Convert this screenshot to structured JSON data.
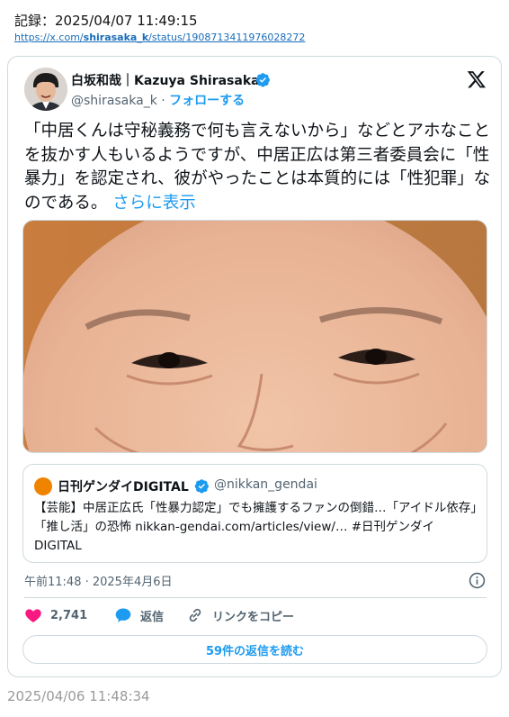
{
  "record": {
    "label": "記録：2025/04/07 11:49:15",
    "url_prefix": "https://x.com/",
    "url_user": "shirasaka_k",
    "url_suffix": "/status/1908713411976028272"
  },
  "tweet": {
    "author_name": "白坂和哉｜Kazuya Shirasaka",
    "author_handle": "@shirasaka_k",
    "separator": "·",
    "follow_label": "フォローする",
    "text": "「中居くんは守秘義務で何も言えないから」などとアホなことを抜かす人もいるようですが、中居正広は第三者委員会に「性暴力」を認定され、彼がやったことは本質的には「性犯罪」なのである。",
    "show_more_label": "さらに表示",
    "timestamp": "午前11:48 · 2025年4月6日",
    "like_count": "2,741",
    "reply_label": "返信",
    "copy_link_label": "リンクをコピー",
    "read_replies_label": "59件の返信を読む"
  },
  "quote": {
    "name": "日刊ゲンダイDIGITAL",
    "handle": "@nikkan_gendai",
    "text": "【芸能】中居正広氏「性暴力認定」でも擁護するファンの倒錯…「アイドル依存」「推し活」の恐怖 nikkan-gendai.com/articles/view/… #日刊ゲンダイDIGITAL"
  },
  "saved_time": "2025/04/06 11:48:34",
  "colors": {
    "accent": "#1d9bf0",
    "like": "#f91880",
    "muted": "#536471",
    "border": "#cfd9de",
    "quote_brand": "#f08300"
  },
  "icons": [
    "verified-badge-icon",
    "x-logo-icon",
    "info-icon",
    "heart-icon",
    "reply-bubble-icon",
    "link-icon"
  ]
}
